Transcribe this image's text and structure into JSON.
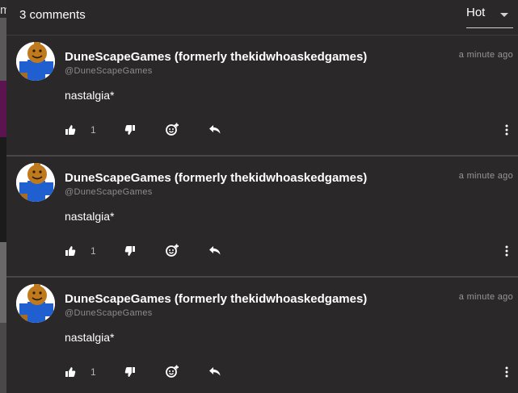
{
  "header": {
    "comment_count": "3 comments",
    "sort": {
      "selected": "Hot"
    }
  },
  "backdrop": {
    "partial_text": "m"
  },
  "comments": [
    {
      "author": "DuneScapeGames (formerly thekidwhoaskedgames)",
      "handle": "@DuneScapeGames",
      "time": "a minute ago",
      "text": "nastalgia*",
      "likes": "1"
    },
    {
      "author": "DuneScapeGames (formerly thekidwhoaskedgames)",
      "handle": "@DuneScapeGames",
      "time": "a minute ago",
      "text": "nastalgia*",
      "likes": "1"
    },
    {
      "author": "DuneScapeGames (formerly thekidwhoaskedgames)",
      "handle": "@DuneScapeGames",
      "time": "a minute ago",
      "text": "nastalgia*",
      "likes": "1"
    }
  ],
  "icons": {
    "like": "thumbs-up-icon",
    "dislike": "thumbs-down-icon",
    "react": "add-reaction-icon",
    "reply": "reply-icon",
    "more": "more-vertical-icon"
  },
  "colors": {
    "background": "#2b2829",
    "text": "#ffffff",
    "muted": "#9a9697",
    "avatar_face": "#c07a1e",
    "avatar_body": "#1f5fd0"
  }
}
